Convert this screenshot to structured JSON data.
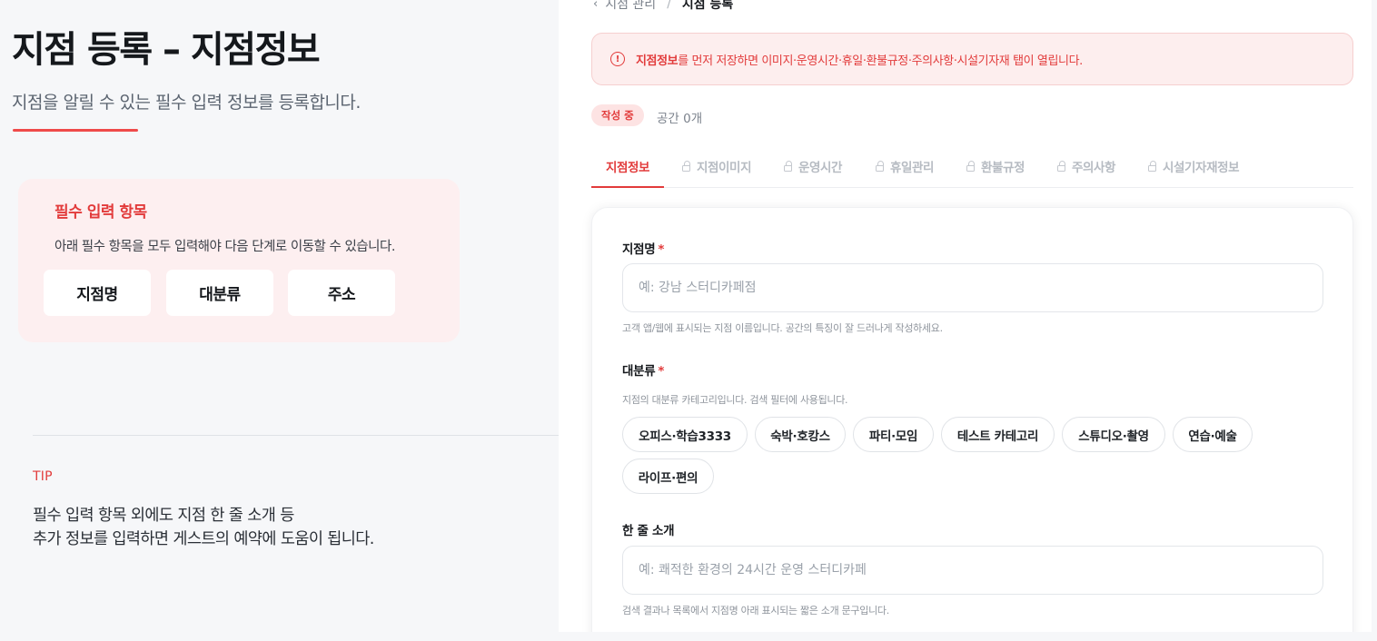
{
  "left": {
    "title": "지점 등록 – 지점정보",
    "subtitle": "지점을 알릴 수 있는 필수 입력 정보를 등록합니다.",
    "required_card": {
      "title": "필수 입력 항목",
      "description": "아래 필수 항목을 모두 입력해야 다음 단계로 이동할 수 있습니다.",
      "items": [
        "지점명",
        "대분류",
        "주소"
      ]
    },
    "tip": {
      "label": "TIP",
      "line1": "필수 입력 항목 외에도 지점 한 줄 소개 등",
      "line2": "추가 정보를 입력하면 게스트의 예약에 도움이 됩니다."
    }
  },
  "breadcrumb": {
    "parent": "지점 관리",
    "separator": "/",
    "current": "지점 등록"
  },
  "alert": {
    "strong": "지점정보",
    "text": "를 먼저 저장하면 이미지·운영시간·휴일·환불규정·주의사항·시설기자재 탭이 열립니다."
  },
  "status": {
    "badge": "작성 중",
    "space_count": "공간 0개"
  },
  "tabs": [
    {
      "label": "지점정보",
      "active": true,
      "locked": false
    },
    {
      "label": "지점이미지",
      "active": false,
      "locked": true
    },
    {
      "label": "운영시간",
      "active": false,
      "locked": true
    },
    {
      "label": "휴일관리",
      "active": false,
      "locked": true
    },
    {
      "label": "환불규정",
      "active": false,
      "locked": true
    },
    {
      "label": "주의사항",
      "active": false,
      "locked": true
    },
    {
      "label": "시설기자재정보",
      "active": false,
      "locked": true
    }
  ],
  "form": {
    "name": {
      "label": "지점명",
      "required_mark": "*",
      "placeholder": "예: 강남 스터디카페점",
      "help": "고객 앱/웹에 표시되는 지점 이름입니다. 공간의 특징이 잘 드러나게 작성하세요."
    },
    "category": {
      "label": "대분류",
      "required_mark": "*",
      "help": "지점의 대분류 카테고리입니다. 검색 필터에 사용됩니다.",
      "options": [
        "오피스·학습3333",
        "숙박·호캉스",
        "파티·모임",
        "테스트 카테고리",
        "스튜디오·촬영",
        "연습·예술",
        "라이프·편의"
      ]
    },
    "intro": {
      "label": "한 줄 소개",
      "placeholder": "예: 쾌적한 환경의 24시간 운영 스터디카페",
      "help": "검색 결과나 목록에서 지점명 아래 표시되는 짧은 소개 문구입니다."
    }
  },
  "colors": {
    "accent": "#e23b3b",
    "alert_bg": "#fdeeee",
    "card_bg": "#fdeff0",
    "page_bg": "#f6f7f9"
  }
}
